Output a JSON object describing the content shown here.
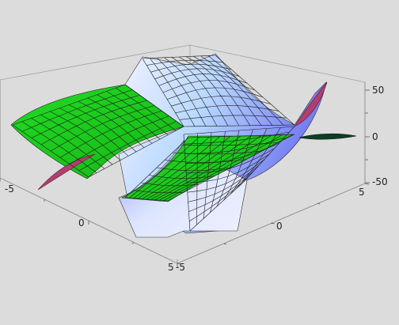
{
  "chart_data": {
    "type": "surface3d",
    "title": "",
    "x_range": [
      -5,
      5
    ],
    "y_range": [
      -5,
      5
    ],
    "z_range": [
      -60,
      60
    ],
    "x_ticks": [
      -5,
      0,
      5
    ],
    "y_ticks": [
      -5,
      0,
      5
    ],
    "z_ticks": [
      -50,
      0,
      50
    ],
    "x_tick_labels": [
      "-5",
      "0",
      "5"
    ],
    "y_tick_labels": [
      "-5",
      "0",
      "5"
    ],
    "z_tick_labels": [
      "50",
      "0",
      "-50"
    ],
    "grid": false,
    "mesh": "on",
    "surfaces": [
      {
        "description": "saddle-like surface, blue-white shading",
        "style": "blue-shaded"
      },
      {
        "description": "nearly planar intersecting sheet",
        "style": "green"
      }
    ],
    "colors": {
      "background": "#dcdcdc",
      "green_surface": "#19d719",
      "blue_surface": "#7f7ff2",
      "light_surface": "#f2f2ff",
      "magenta_edge": "#b0406e",
      "dark_edge": "#0e3d25",
      "mesh": "#202020"
    }
  }
}
